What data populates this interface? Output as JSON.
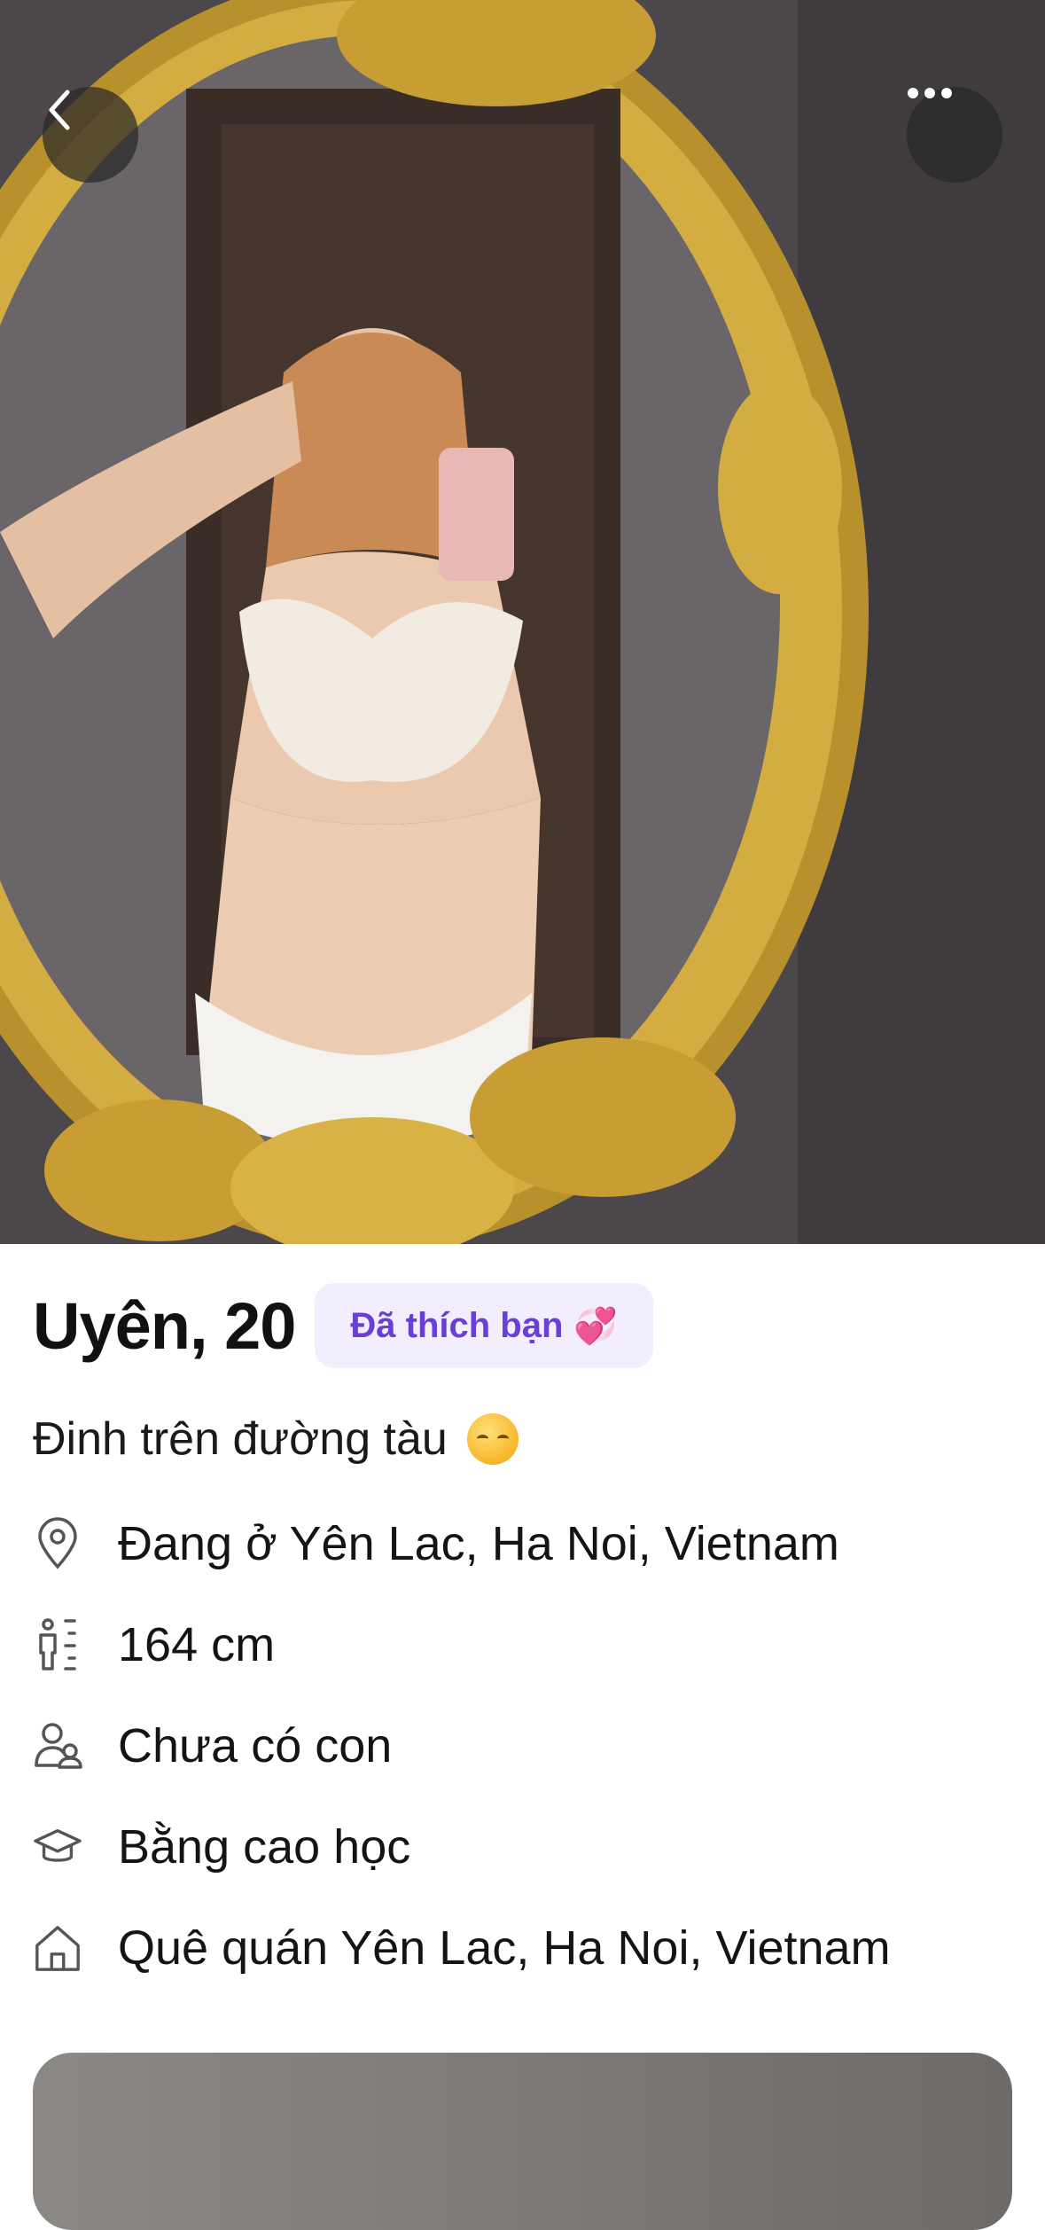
{
  "profile": {
    "name_age": "Uyên, 20",
    "liked_badge": "Đã thích bạn",
    "bio": "Đinh trên đường tàu"
  },
  "details": [
    {
      "icon": "location-pin-icon",
      "label": "Đang ở Yên Lac, Ha Noi, Vietnam"
    },
    {
      "icon": "height-icon",
      "label": "164 cm"
    },
    {
      "icon": "people-icon",
      "label": "Chưa có con"
    },
    {
      "icon": "graduation-cap-icon",
      "label": "Bằng cao học"
    },
    {
      "icon": "home-icon",
      "label": "Quê quán Yên Lac, Ha Noi, Vietnam"
    }
  ],
  "colors": {
    "badge_background": "#f2eefe",
    "badge_text": "#6a3fd8",
    "text_primary": "#121212"
  }
}
